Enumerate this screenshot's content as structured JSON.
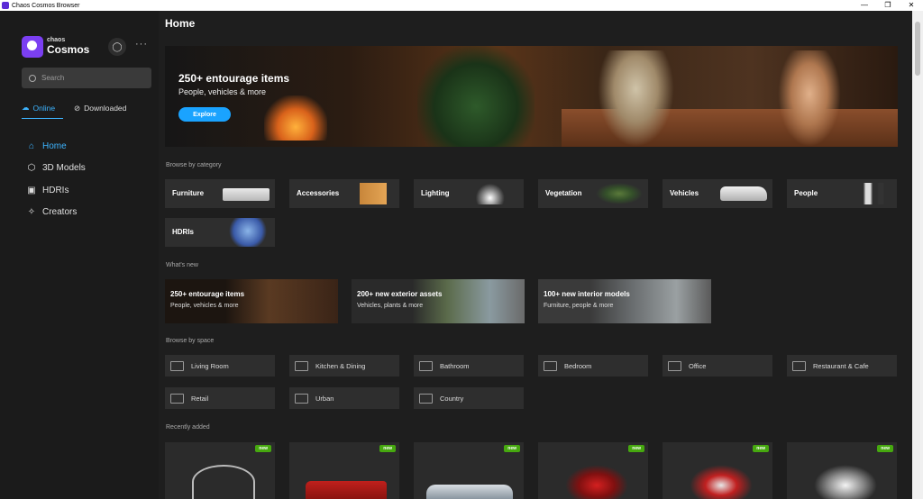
{
  "window": {
    "title": "Chaos Cosmos Browser",
    "controls": [
      "—",
      "❐",
      "✕"
    ]
  },
  "sidebar": {
    "brand_small": "chaos",
    "brand_name": "Cosmos",
    "more_label": "···",
    "search_placeholder": "Search",
    "tabs": [
      {
        "label": "Online",
        "active": true
      },
      {
        "label": "Downloaded",
        "active": false
      }
    ],
    "nav": [
      {
        "label": "Home",
        "icon": "home-icon",
        "active": true
      },
      {
        "label": "3D Models",
        "icon": "cube-icon",
        "active": false
      },
      {
        "label": "HDRIs",
        "icon": "image-icon",
        "active": false
      },
      {
        "label": "Creators",
        "icon": "sparkle-icon",
        "active": false
      }
    ]
  },
  "main": {
    "title": "Home",
    "hero": {
      "title": "250+ entourage items",
      "subtitle": "People, vehicles & more",
      "button": "Explore"
    },
    "browse_category_label": "Browse by category",
    "categories": [
      "Furniture",
      "Accessories",
      "Lighting",
      "Vegetation",
      "Vehicles",
      "People",
      "HDRIs"
    ],
    "whats_new_label": "What's new",
    "whats_new": [
      {
        "title": "250+ entourage items",
        "subtitle": "People, vehicles & more"
      },
      {
        "title": "200+ new exterior assets",
        "subtitle": "Vehicles, plants & more"
      },
      {
        "title": "100+ new interior models",
        "subtitle": "Furniture, people & more"
      }
    ],
    "browse_space_label": "Browse by space",
    "spaces": [
      "Living Room",
      "Kitchen & Dining",
      "Bathroom",
      "Bedroom",
      "Office",
      "Restaurant & Cafe",
      "Retail",
      "Urban",
      "Country"
    ],
    "recent_label": "Recently added",
    "recent_badge": "new",
    "colors": {
      "accent": "#3db4ff",
      "button": "#1aa3ff",
      "badge": "#46a80f",
      "brand": "#7b3ff2"
    }
  }
}
